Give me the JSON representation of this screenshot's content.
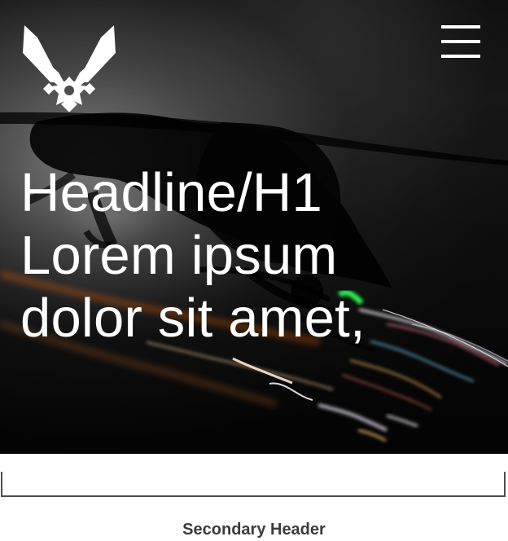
{
  "hero": {
    "headline": "Headline/H1\nLorem ipsum\ndolor sit amet,",
    "logo_icon": "air-force-wing-star-icon",
    "menu_icon": "hamburger-menu-icon",
    "text_color": "#FFFFFF"
  },
  "content": {
    "secondary_header": "Secondary Header"
  },
  "theme": {
    "background": "#FFFFFF",
    "divider_color": "#4E4E4E",
    "secondary_text_color": "#3B3B3B"
  }
}
